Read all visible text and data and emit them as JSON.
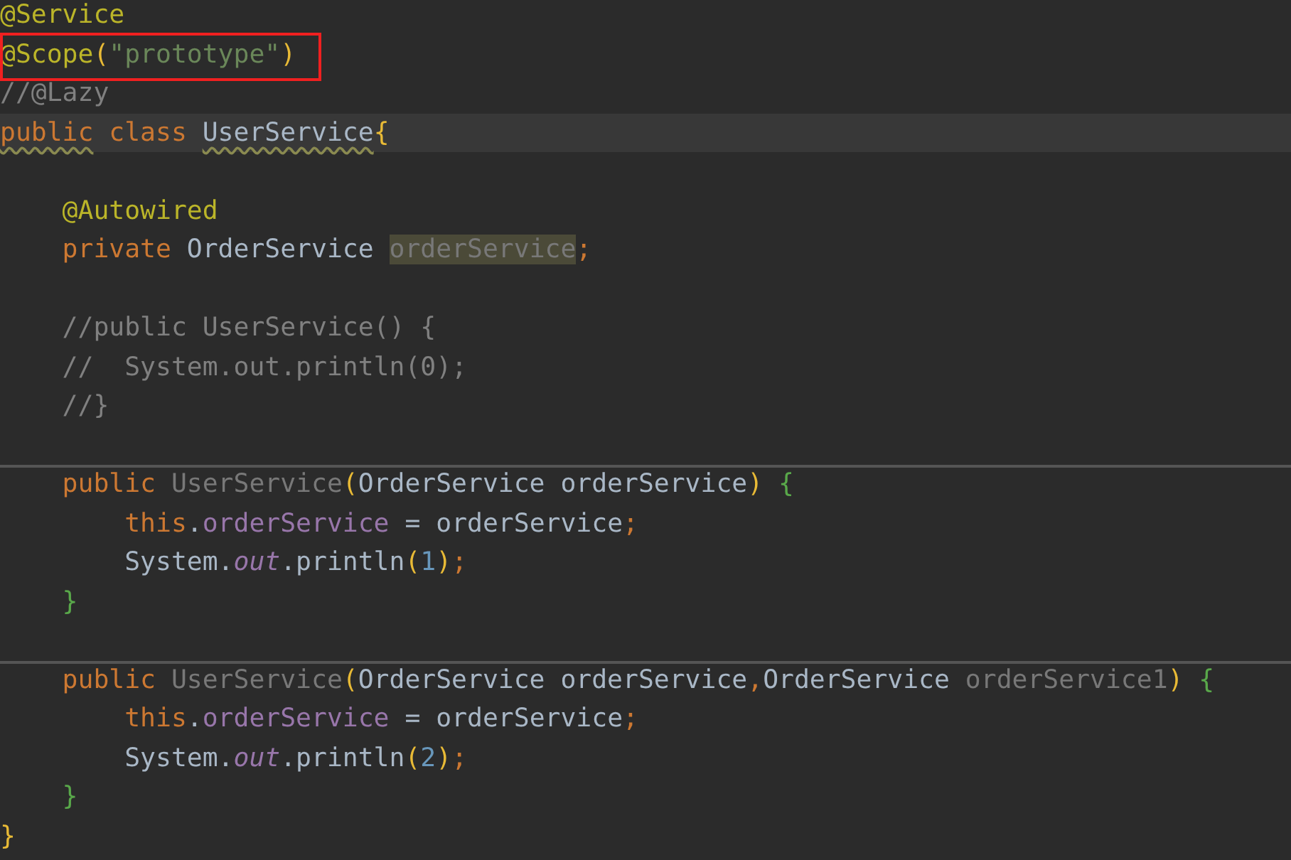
{
  "editor": {
    "lines": [
      {
        "current": false,
        "boxed": false,
        "separator_above": false,
        "tokens": [
          {
            "text": "@Service",
            "kind": "annotation"
          }
        ]
      },
      {
        "current": false,
        "boxed": true,
        "separator_above": false,
        "tokens": [
          {
            "text": "@Scope",
            "kind": "annotation"
          },
          {
            "text": "(",
            "kind": "paren"
          },
          {
            "text": "\"prototype\"",
            "kind": "string"
          },
          {
            "text": ")",
            "kind": "paren"
          }
        ]
      },
      {
        "current": false,
        "boxed": false,
        "separator_above": false,
        "tokens": [
          {
            "text": "//@Lazy",
            "kind": "comment"
          }
        ]
      },
      {
        "current": true,
        "boxed": false,
        "separator_above": false,
        "tokens": [
          {
            "text": "public",
            "kind": "keyword-warn"
          },
          {
            "text": " class ",
            "kind": "keyword"
          },
          {
            "text": "UserService",
            "kind": "class-warn"
          },
          {
            "text": "{",
            "kind": "paren"
          }
        ]
      },
      {
        "current": false,
        "boxed": false,
        "separator_above": false
      },
      {
        "current": false,
        "boxed": false,
        "separator_above": false,
        "tokens": [
          {
            "text": "    @Autowired",
            "kind": "annotation"
          }
        ]
      },
      {
        "current": false,
        "boxed": false,
        "separator_above": false,
        "tokens": [
          {
            "text": "    private",
            "kind": "keyword"
          },
          {
            "text": " OrderService ",
            "kind": "plain"
          },
          {
            "text": "orderService",
            "kind": "unused-highlighted"
          },
          {
            "text": ";",
            "kind": "keyword"
          }
        ]
      },
      {
        "current": false,
        "boxed": false,
        "separator_above": false
      },
      {
        "current": false,
        "boxed": false,
        "separator_above": false,
        "tokens": [
          {
            "text": "    //public UserService() {",
            "kind": "comment"
          }
        ]
      },
      {
        "current": false,
        "boxed": false,
        "separator_above": false,
        "tokens": [
          {
            "text": "    //  System.out.println(0);",
            "kind": "comment"
          }
        ]
      },
      {
        "current": false,
        "boxed": false,
        "separator_above": false,
        "tokens": [
          {
            "text": "    //}",
            "kind": "comment"
          }
        ]
      },
      {
        "current": false,
        "boxed": false,
        "separator_above": false
      },
      {
        "current": false,
        "boxed": false,
        "separator_above": true,
        "tokens": [
          {
            "text": "    public",
            "kind": "keyword"
          },
          {
            "text": " UserService",
            "kind": "unused"
          },
          {
            "text": "(",
            "kind": "paren"
          },
          {
            "text": "OrderService orderService",
            "kind": "plain"
          },
          {
            "text": ")",
            "kind": "paren"
          },
          {
            "text": " {",
            "kind": "brace"
          }
        ]
      },
      {
        "current": false,
        "boxed": false,
        "separator_above": false,
        "tokens": [
          {
            "text": "        this",
            "kind": "keyword"
          },
          {
            "text": ".",
            "kind": "plain"
          },
          {
            "text": "orderService",
            "kind": "field"
          },
          {
            "text": " = orderService",
            "kind": "plain"
          },
          {
            "text": ";",
            "kind": "keyword"
          }
        ]
      },
      {
        "current": false,
        "boxed": false,
        "separator_above": false,
        "tokens": [
          {
            "text": "        System.",
            "kind": "plain"
          },
          {
            "text": "out",
            "kind": "static"
          },
          {
            "text": ".println",
            "kind": "plain"
          },
          {
            "text": "(",
            "kind": "paren"
          },
          {
            "text": "1",
            "kind": "number"
          },
          {
            "text": ")",
            "kind": "paren"
          },
          {
            "text": ";",
            "kind": "keyword"
          }
        ]
      },
      {
        "current": false,
        "boxed": false,
        "separator_above": false,
        "tokens": [
          {
            "text": "    }",
            "kind": "brace"
          }
        ]
      },
      {
        "current": false,
        "boxed": false,
        "separator_above": false
      },
      {
        "current": false,
        "boxed": false,
        "separator_above": true,
        "tokens": [
          {
            "text": "    public",
            "kind": "keyword"
          },
          {
            "text": " UserService",
            "kind": "unused"
          },
          {
            "text": "(",
            "kind": "paren"
          },
          {
            "text": "OrderService orderService",
            "kind": "plain"
          },
          {
            "text": ",",
            "kind": "keyword"
          },
          {
            "text": "OrderService",
            "kind": "plain"
          },
          {
            "text": " orderService1",
            "kind": "unused"
          },
          {
            "text": ")",
            "kind": "paren"
          },
          {
            "text": " {",
            "kind": "brace"
          }
        ]
      },
      {
        "current": false,
        "boxed": false,
        "separator_above": false,
        "tokens": [
          {
            "text": "        this",
            "kind": "keyword"
          },
          {
            "text": ".",
            "kind": "plain"
          },
          {
            "text": "orderService",
            "kind": "field"
          },
          {
            "text": " = orderService",
            "kind": "plain"
          },
          {
            "text": ";",
            "kind": "keyword"
          }
        ]
      },
      {
        "current": false,
        "boxed": false,
        "separator_above": false,
        "tokens": [
          {
            "text": "        System.",
            "kind": "plain"
          },
          {
            "text": "out",
            "kind": "static"
          },
          {
            "text": ".println",
            "kind": "plain"
          },
          {
            "text": "(",
            "kind": "paren"
          },
          {
            "text": "2",
            "kind": "number"
          },
          {
            "text": ")",
            "kind": "paren"
          },
          {
            "text": ";",
            "kind": "keyword"
          }
        ]
      },
      {
        "current": false,
        "boxed": false,
        "separator_above": false,
        "tokens": [
          {
            "text": "    }",
            "kind": "brace"
          }
        ]
      },
      {
        "current": false,
        "boxed": false,
        "separator_above": false,
        "tokens": [
          {
            "text": "}",
            "kind": "paren"
          }
        ]
      }
    ]
  }
}
